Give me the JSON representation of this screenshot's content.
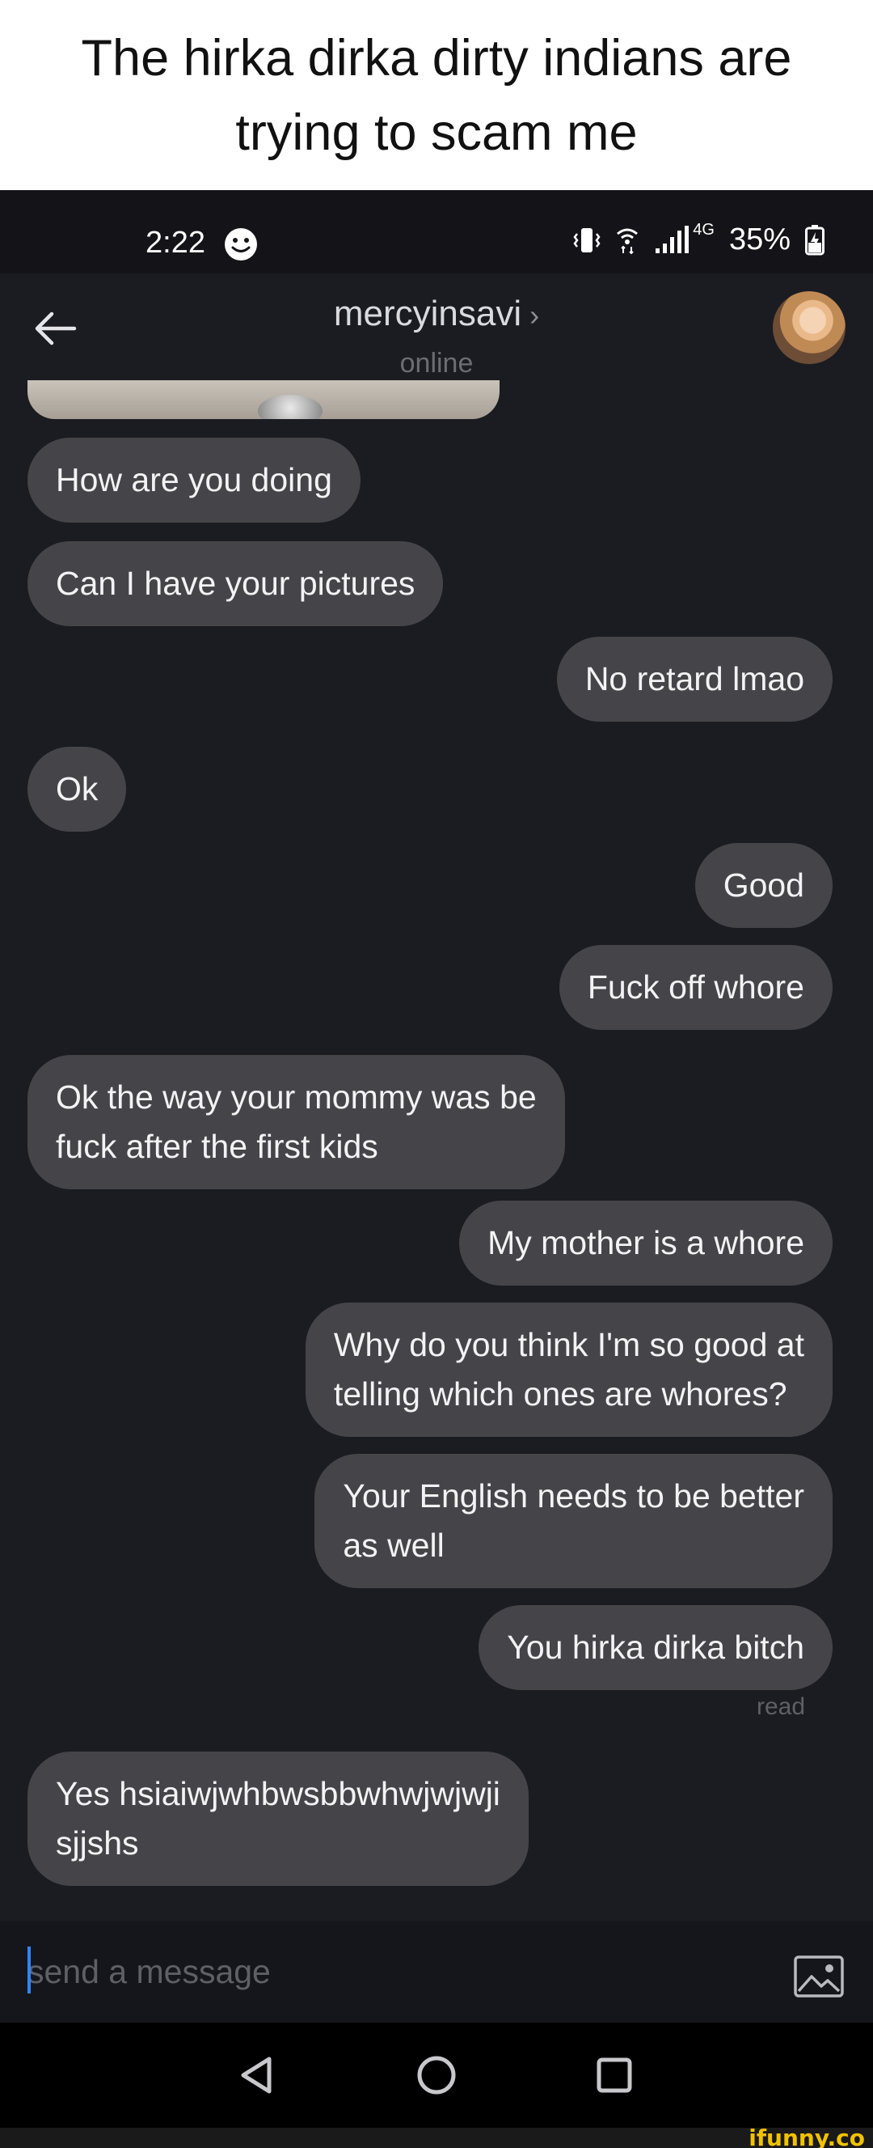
{
  "caption": "The hirka dirka dirty indians are trying to scam me",
  "status": {
    "time": "2:22",
    "network": "4G",
    "battery": "35%"
  },
  "header": {
    "contact": "mercyinsavi",
    "chevron": "›",
    "presence": "online"
  },
  "messages": [
    {
      "side": "left",
      "text": "How are you doing"
    },
    {
      "side": "left",
      "text": "Can I have your pictures"
    },
    {
      "side": "right",
      "text": "No retard lmao"
    },
    {
      "side": "left",
      "text": "Ok"
    },
    {
      "side": "right",
      "text": "Good"
    },
    {
      "side": "right",
      "text": "Fuck off whore"
    },
    {
      "side": "left",
      "text": "Ok the way your mommy was be\nfuck after the first kids"
    },
    {
      "side": "right",
      "text": "My mother is a whore"
    },
    {
      "side": "right",
      "text": "Why do you think I'm so good at\ntelling which ones are whores?"
    },
    {
      "side": "right",
      "text": "Your English needs to be better\nas well"
    },
    {
      "side": "right",
      "text": "You hirka dirka bitch"
    },
    {
      "side": "left",
      "text": "Yes  hsiaiwjwhbwsbbwhwjwjwji\nsjjshs"
    }
  ],
  "read_receipt": "read",
  "composer": {
    "placeholder": "send a message"
  },
  "watermark": "ifunny.co",
  "colors": {
    "bubble": "#454549",
    "background": "#1b1c21",
    "cursor": "#2f86ff"
  }
}
